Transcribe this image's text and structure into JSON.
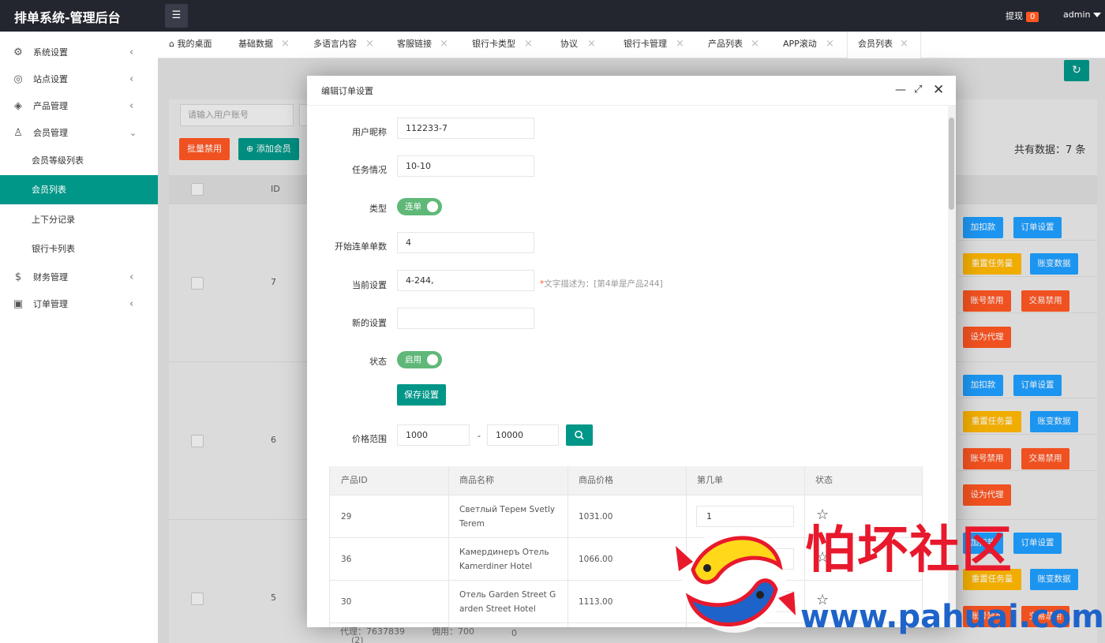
{
  "app": {
    "title": "排单系统-管理后台"
  },
  "header": {
    "withdraw_label": "提现",
    "withdraw_count": "0",
    "user": "admin"
  },
  "sidebar": {
    "items": [
      {
        "label": "系统设置",
        "icon": "gear-icon"
      },
      {
        "label": "站点设置",
        "icon": "site-icon"
      },
      {
        "label": "产品管理",
        "icon": "cube-icon"
      },
      {
        "label": "会员管理",
        "icon": "user-icon"
      },
      {
        "label": "财务管理",
        "icon": "dollar-icon"
      },
      {
        "label": "订单管理",
        "icon": "box-icon"
      }
    ],
    "sub_items": [
      "会员等级列表",
      "会员列表",
      "上下分记录",
      "银行卡列表"
    ],
    "active": "会员列表"
  },
  "tabs": [
    "我的桌面",
    "基础数据",
    "多语言内容",
    "客服链接",
    "银行卡类型",
    "协议",
    "银行卡管理",
    "产品列表",
    "APP滚动",
    "会员列表"
  ],
  "background": {
    "search_placeholder": "请输入用户账号",
    "batch_disable": "批量禁用",
    "add_member": "添加会员",
    "total": "共有数据：7 条",
    "id_header": "ID",
    "rows": [
      {
        "id": "7"
      },
      {
        "id": "6"
      },
      {
        "id": "5"
      }
    ],
    "row_partial": {
      "a": "代理：7637839",
      "b": "(2)",
      "c": "佣用：700",
      "d": "0"
    },
    "actions": {
      "add_deduct": "加扣款",
      "order_settings": "订单设置",
      "reset_tasks": "重置任务量",
      "account_changes": "账变数据",
      "account_disable": "账号禁用",
      "trade_disable": "交易禁用",
      "set_agent": "设为代理"
    }
  },
  "modal": {
    "title": "编辑订单设置",
    "fields": {
      "nickname_label": "用户昵称",
      "nickname": "112233-7",
      "task_label": "任务情况",
      "task": "10-10",
      "type_label": "类型",
      "type_switch": "连单",
      "start_label": "开始连单单数",
      "start": "4",
      "current_label": "当前设置",
      "current": "4-244,",
      "current_hint": "文字描述为：[第4单是产品244]",
      "current_hint_star": "*",
      "new_label": "新的设置",
      "new": "",
      "status_label": "状态",
      "status_switch": "启用",
      "save": "保存设置",
      "price_label": "价格范围",
      "price_min": "1000",
      "price_max": "10000",
      "price_dash": "-"
    },
    "table": {
      "headers": [
        "产品ID",
        "商品名称",
        "商品价格",
        "第几单",
        "状态"
      ],
      "rows": [
        {
          "id": "29",
          "name": "Светлый Терем Svetly Terem",
          "price": "1031.00",
          "order": "1"
        },
        {
          "id": "36",
          "name": "Камердинеръ Отель Kamerdiner Hotel",
          "price": "1066.00",
          "order": ""
        },
        {
          "id": "30",
          "name": "Отель Garden Street Garden Street Hotel",
          "price": "1113.00",
          "order": ""
        }
      ]
    }
  },
  "watermark": {
    "text": "怕坏社区",
    "url": "www.pahuai.com"
  }
}
